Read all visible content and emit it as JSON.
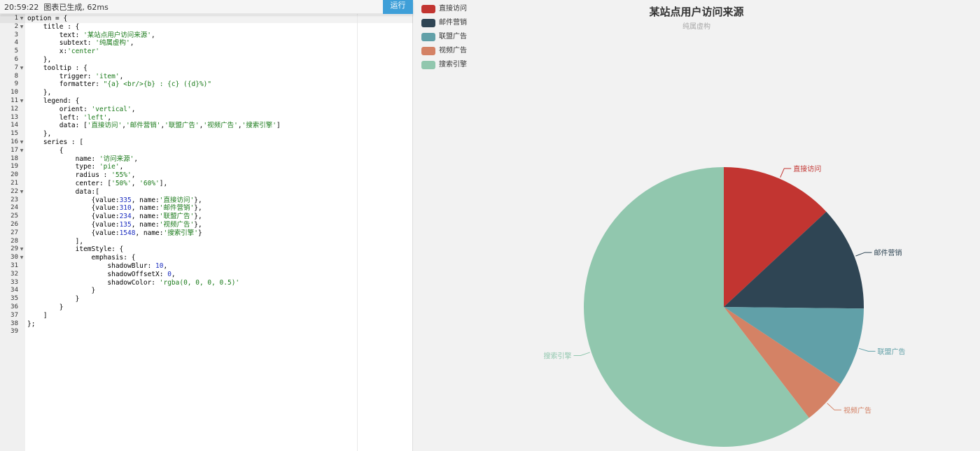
{
  "status_bar": {
    "text": "20:59:22  图表已生成, 62ms",
    "run_label": "运行"
  },
  "code_lines": [
    [
      {
        "t": "option = {"
      }
    ],
    [
      {
        "t": "    title : {"
      }
    ],
    [
      {
        "t": "        text: "
      },
      {
        "t": "'某站点用户访问来源'",
        "c": "str"
      },
      {
        "t": ","
      }
    ],
    [
      {
        "t": "        subtext: "
      },
      {
        "t": "'纯属虚构'",
        "c": "str"
      },
      {
        "t": ","
      }
    ],
    [
      {
        "t": "        x:"
      },
      {
        "t": "'center'",
        "c": "str"
      }
    ],
    [
      {
        "t": "    },"
      }
    ],
    [
      {
        "t": "    tooltip : {"
      }
    ],
    [
      {
        "t": "        trigger: "
      },
      {
        "t": "'item'",
        "c": "str"
      },
      {
        "t": ","
      }
    ],
    [
      {
        "t": "        formatter: "
      },
      {
        "t": "\"{a} <br/>{b} : {c} ({d}%)\"",
        "c": "str"
      }
    ],
    [
      {
        "t": "    },"
      }
    ],
    [
      {
        "t": "    legend: {"
      }
    ],
    [
      {
        "t": "        orient: "
      },
      {
        "t": "'vertical'",
        "c": "str"
      },
      {
        "t": ","
      }
    ],
    [
      {
        "t": "        left: "
      },
      {
        "t": "'left'",
        "c": "str"
      },
      {
        "t": ","
      }
    ],
    [
      {
        "t": "        data: ["
      },
      {
        "t": "'直接访问'",
        "c": "str"
      },
      {
        "t": ","
      },
      {
        "t": "'邮件营销'",
        "c": "str"
      },
      {
        "t": ","
      },
      {
        "t": "'联盟广告'",
        "c": "str"
      },
      {
        "t": ","
      },
      {
        "t": "'视频广告'",
        "c": "str"
      },
      {
        "t": ","
      },
      {
        "t": "'搜索引擎'",
        "c": "str"
      },
      {
        "t": "]"
      }
    ],
    [
      {
        "t": "    },"
      }
    ],
    [
      {
        "t": "    series : ["
      }
    ],
    [
      {
        "t": "        {"
      }
    ],
    [
      {
        "t": "            name: "
      },
      {
        "t": "'访问来源'",
        "c": "str"
      },
      {
        "t": ","
      }
    ],
    [
      {
        "t": "            type: "
      },
      {
        "t": "'pie'",
        "c": "str"
      },
      {
        "t": ","
      }
    ],
    [
      {
        "t": "            radius : "
      },
      {
        "t": "'55%'",
        "c": "str"
      },
      {
        "t": ","
      }
    ],
    [
      {
        "t": "            center: ["
      },
      {
        "t": "'50%'",
        "c": "str"
      },
      {
        "t": ", "
      },
      {
        "t": "'60%'",
        "c": "str"
      },
      {
        "t": "],"
      }
    ],
    [
      {
        "t": "            data:["
      }
    ],
    [
      {
        "t": "                {value:"
      },
      {
        "t": "335",
        "c": "num"
      },
      {
        "t": ", name:"
      },
      {
        "t": "'直接访问'",
        "c": "str"
      },
      {
        "t": "},"
      }
    ],
    [
      {
        "t": "                {value:"
      },
      {
        "t": "310",
        "c": "num"
      },
      {
        "t": ", name:"
      },
      {
        "t": "'邮件营销'",
        "c": "str"
      },
      {
        "t": "},"
      }
    ],
    [
      {
        "t": "                {value:"
      },
      {
        "t": "234",
        "c": "num"
      },
      {
        "t": ", name:"
      },
      {
        "t": "'联盟广告'",
        "c": "str"
      },
      {
        "t": "},"
      }
    ],
    [
      {
        "t": "                {value:"
      },
      {
        "t": "135",
        "c": "num"
      },
      {
        "t": ", name:"
      },
      {
        "t": "'视频广告'",
        "c": "str"
      },
      {
        "t": "},"
      }
    ],
    [
      {
        "t": "                {value:"
      },
      {
        "t": "1548",
        "c": "num"
      },
      {
        "t": ", name:"
      },
      {
        "t": "'搜索引擎'",
        "c": "str"
      },
      {
        "t": "}"
      }
    ],
    [
      {
        "t": "            ],"
      }
    ],
    [
      {
        "t": "            itemStyle: {"
      }
    ],
    [
      {
        "t": "                emphasis: {"
      }
    ],
    [
      {
        "t": "                    shadowBlur: "
      },
      {
        "t": "10",
        "c": "num"
      },
      {
        "t": ","
      }
    ],
    [
      {
        "t": "                    shadowOffsetX: "
      },
      {
        "t": "0",
        "c": "num"
      },
      {
        "t": ","
      }
    ],
    [
      {
        "t": "                    shadowColor: "
      },
      {
        "t": "'rgba(0, 0, 0, 0.5)'",
        "c": "str"
      }
    ],
    [
      {
        "t": "                }"
      }
    ],
    [
      {
        "t": "            }"
      }
    ],
    [
      {
        "t": "        }"
      }
    ],
    [
      {
        "t": "    ]"
      }
    ],
    [
      {
        "t": "};"
      }
    ],
    [
      {
        "t": ""
      }
    ]
  ],
  "fold_lines": [
    1,
    2,
    7,
    11,
    16,
    17,
    22,
    29,
    30
  ],
  "chart_data": {
    "type": "pie",
    "title": "某站点用户访问来源",
    "subtitle": "纯属虚构",
    "legend_position": "top-left",
    "series": [
      {
        "name": "访问来源",
        "data": [
          {
            "name": "直接访问",
            "value": 335,
            "color": "#c23531"
          },
          {
            "name": "邮件营销",
            "value": 310,
            "color": "#2f4554"
          },
          {
            "name": "联盟广告",
            "value": 234,
            "color": "#61a0a8"
          },
          {
            "name": "视频广告",
            "value": 135,
            "color": "#d48265"
          },
          {
            "name": "搜索引擎",
            "value": 1548,
            "color": "#91c7ae"
          }
        ]
      }
    ]
  }
}
